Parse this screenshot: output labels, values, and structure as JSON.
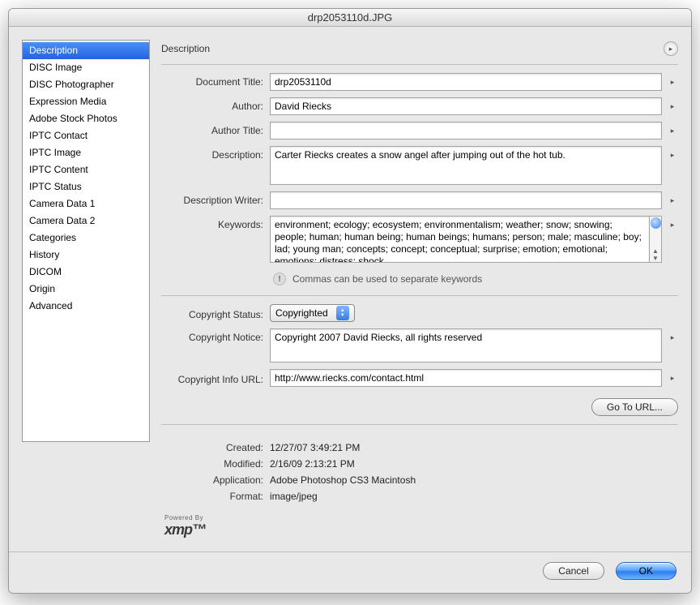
{
  "window": {
    "title": "drp2053110d.JPG"
  },
  "sidebar": {
    "items": [
      {
        "label": "Description",
        "selected": true
      },
      {
        "label": "DISC Image"
      },
      {
        "label": "DISC Photographer"
      },
      {
        "label": "Expression Media"
      },
      {
        "label": "Adobe Stock Photos"
      },
      {
        "label": "IPTC Contact"
      },
      {
        "label": "IPTC Image"
      },
      {
        "label": "IPTC Content"
      },
      {
        "label": "IPTC Status"
      },
      {
        "label": "Camera Data 1"
      },
      {
        "label": "Camera Data 2"
      },
      {
        "label": "Categories"
      },
      {
        "label": "History"
      },
      {
        "label": "DICOM"
      },
      {
        "label": "Origin"
      },
      {
        "label": "Advanced"
      }
    ]
  },
  "panel": {
    "title": "Description",
    "labels": {
      "document_title": "Document Title:",
      "author": "Author:",
      "author_title": "Author Title:",
      "description": "Description:",
      "description_writer": "Description Writer:",
      "keywords": "Keywords:",
      "copyright_status": "Copyright Status:",
      "copyright_notice": "Copyright Notice:",
      "copyright_info_url": "Copyright Info URL:"
    },
    "values": {
      "document_title": "drp2053110d",
      "author": "David Riecks",
      "author_title": "",
      "description": "Carter Riecks creates a snow angel after jumping out of the hot tub.",
      "description_writer": "",
      "keywords": "environment; ecology; ecosystem; environmentalism; weather; snow; snowing; people; human; human being; human beings; humans; person; male; masculine; boy; lad; young man; concepts; concept; conceptual; surprise; emotion; emotional; emotions; distress; shock",
      "copyright_status": "Copyrighted",
      "copyright_notice": "Copyright 2007 David Riecks, all rights reserved",
      "copyright_info_url": "http://www.riecks.com/contact.html"
    },
    "hint": "Commas can be used to separate keywords",
    "goto_url_label": "Go To URL..."
  },
  "meta": {
    "labels": {
      "created": "Created:",
      "modified": "Modified:",
      "application": "Application:",
      "format": "Format:"
    },
    "values": {
      "created": "12/27/07 3:49:21 PM",
      "modified": "2/16/09 2:13:21 PM",
      "application": "Adobe Photoshop CS3 Macintosh",
      "format": "image/jpeg"
    }
  },
  "xmp": {
    "powered_by": "Powered By",
    "logo": "xmp"
  },
  "footer": {
    "cancel": "Cancel",
    "ok": "OK"
  }
}
